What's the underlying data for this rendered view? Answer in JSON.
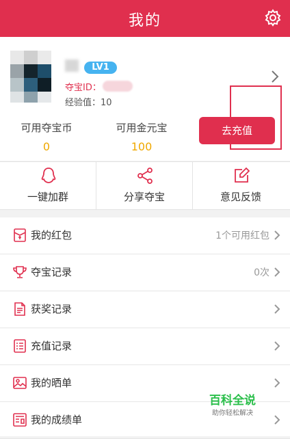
{
  "header": {
    "title": "我的",
    "settings_icon": "gear-icon"
  },
  "profile": {
    "level": "LV1",
    "id_label": "夺宝ID：",
    "exp": "经验值：10"
  },
  "stats": {
    "coins_label": "可用夺宝币",
    "coins_value": "0",
    "gold_label": "可用金元宝",
    "gold_value": "100",
    "recharge": "去充值"
  },
  "actions": [
    {
      "label": "一键加群",
      "icon": "qq-penguin-icon"
    },
    {
      "label": "分享夺宝",
      "icon": "share-icon"
    },
    {
      "label": "意见反馈",
      "icon": "edit-icon"
    }
  ],
  "menu": [
    {
      "label": "我的红包",
      "right": "1个可用红包",
      "icon": "red-envelope-icon"
    },
    {
      "label": "夺宝记录",
      "right": "0次",
      "icon": "trophy-icon"
    },
    {
      "label": "获奖记录",
      "right": "",
      "icon": "document-icon"
    },
    {
      "label": "充值记录",
      "right": "",
      "icon": "list-icon"
    },
    {
      "label": "我的晒单",
      "right": "",
      "icon": "image-icon"
    },
    {
      "label": "我的成绩单",
      "right": "",
      "icon": "report-icon"
    }
  ],
  "watermark": {
    "title": "百科全说",
    "subtitle": "助你轻松解决"
  },
  "colors": {
    "accent": "#e02f4e",
    "level_badge": "#46b3f0",
    "value": "#f0a800"
  }
}
